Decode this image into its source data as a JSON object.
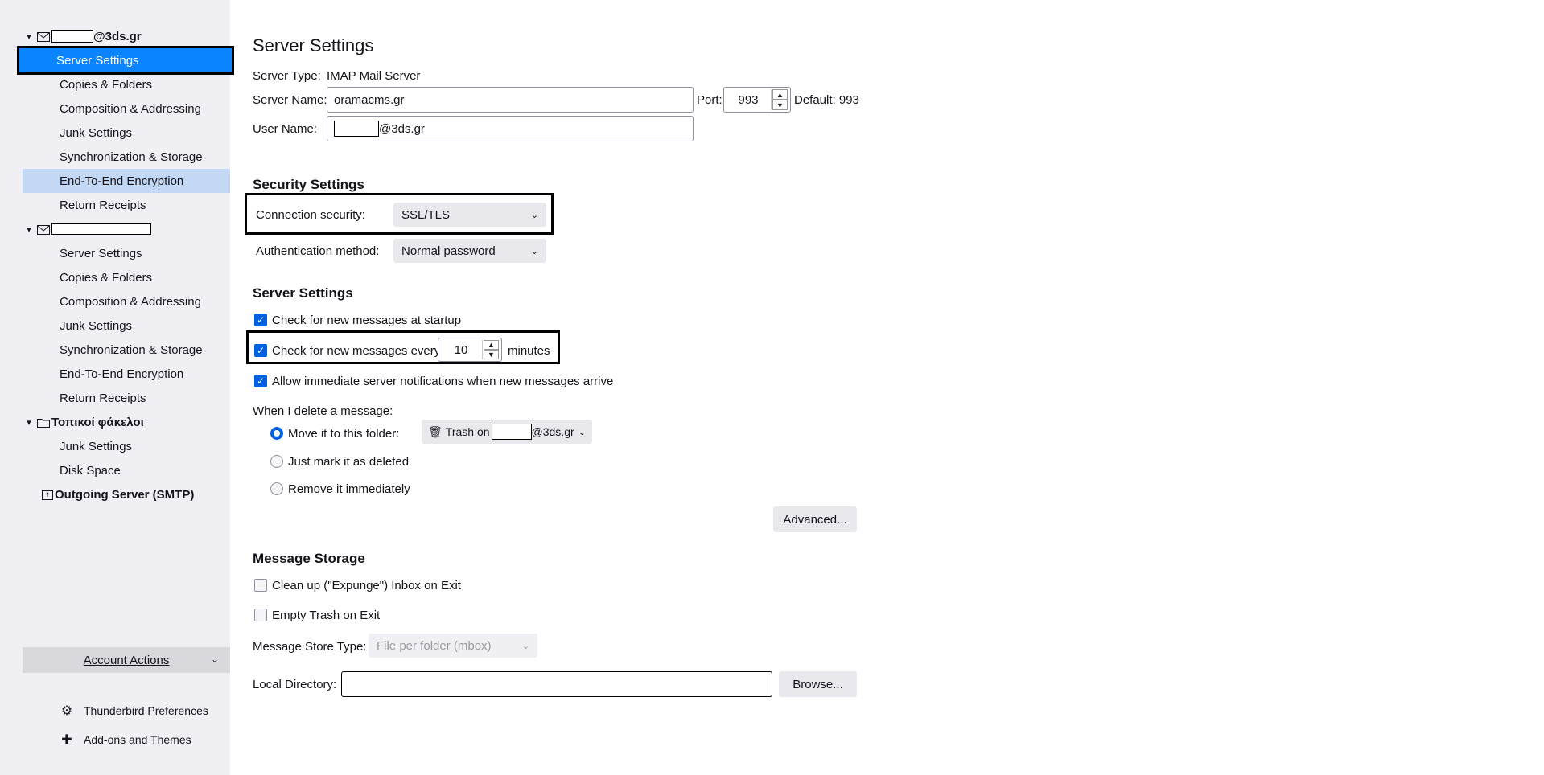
{
  "sidebar": {
    "account1": {
      "email_suffix": "@3ds.gr",
      "items": [
        "Server Settings",
        "Copies & Folders",
        "Composition & Addressing",
        "Junk Settings",
        "Synchronization & Storage",
        "End-To-End Encryption",
        "Return Receipts"
      ]
    },
    "account2": {
      "items": [
        "Server Settings",
        "Copies & Folders",
        "Composition & Addressing",
        "Junk Settings",
        "Synchronization & Storage",
        "End-To-End Encryption",
        "Return Receipts"
      ]
    },
    "local_folders": {
      "label": "Τοπικοί φάκελοι",
      "items": [
        "Junk Settings",
        "Disk Space"
      ]
    },
    "smtp": {
      "label": "Outgoing Server (SMTP)"
    },
    "account_actions": "Account Actions",
    "preferences": "Thunderbird Preferences",
    "addons": "Add-ons and Themes"
  },
  "main": {
    "title": "Server Settings",
    "server_type_label": "Server Type:",
    "server_type_value": "IMAP Mail Server",
    "server_name_label": "Server Name:",
    "server_name_value": "oramacms.gr",
    "port_label": "Port:",
    "port_value": "993",
    "default_port": "Default: 993",
    "user_name_label": "User Name:",
    "user_name_suffix": "@3ds.gr",
    "security": {
      "title": "Security Settings",
      "connection_label": "Connection security:",
      "connection_value": "SSL/TLS",
      "auth_label": "Authentication method:",
      "auth_value": "Normal password"
    },
    "server_settings": {
      "title": "Server Settings",
      "check_startup": "Check for new messages at startup",
      "check_every": "Check for new messages every",
      "check_every_value": "10",
      "minutes": "minutes",
      "allow_notifications": "Allow immediate server notifications when new messages arrive",
      "delete_label": "When I delete a message:",
      "move_to_folder": "Move it to this folder:",
      "trash_prefix": "Trash on",
      "trash_suffix": "@3ds.gr",
      "mark_deleted": "Just mark it as deleted",
      "remove_immediately": "Remove it immediately",
      "advanced_button": "Advanced..."
    },
    "storage": {
      "title": "Message Storage",
      "cleanup": "Clean up (\"Expunge\") Inbox on Exit",
      "empty_trash": "Empty Trash on Exit",
      "store_type_label": "Message Store Type:",
      "store_type_value": "File per folder (mbox)",
      "local_dir_label": "Local Directory:",
      "local_dir_value": "",
      "browse_button": "Browse..."
    }
  }
}
